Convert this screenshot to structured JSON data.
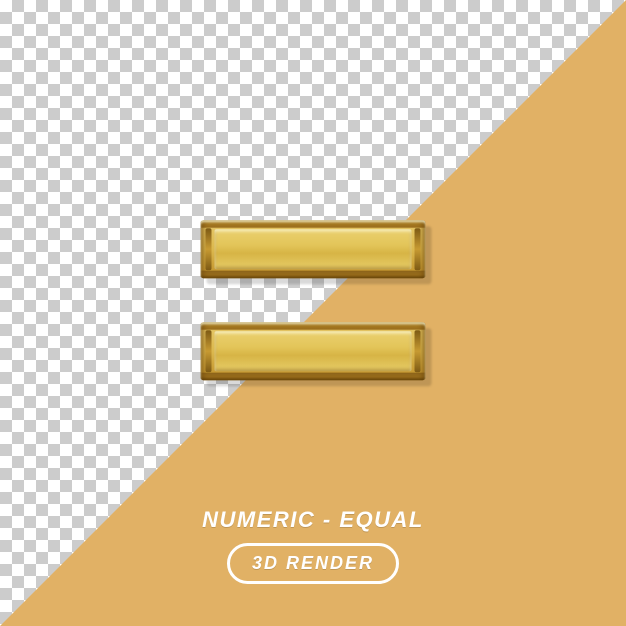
{
  "caption": {
    "title": "NUMERIC - EQUAL",
    "badge": "3D RENDER"
  },
  "colors": {
    "accent": "#e1b165",
    "gold_light": "#ead06f",
    "gold_dark": "#8d641a",
    "text": "#ffffff"
  },
  "symbol": {
    "name": "equals-sign",
    "glyph": "="
  }
}
